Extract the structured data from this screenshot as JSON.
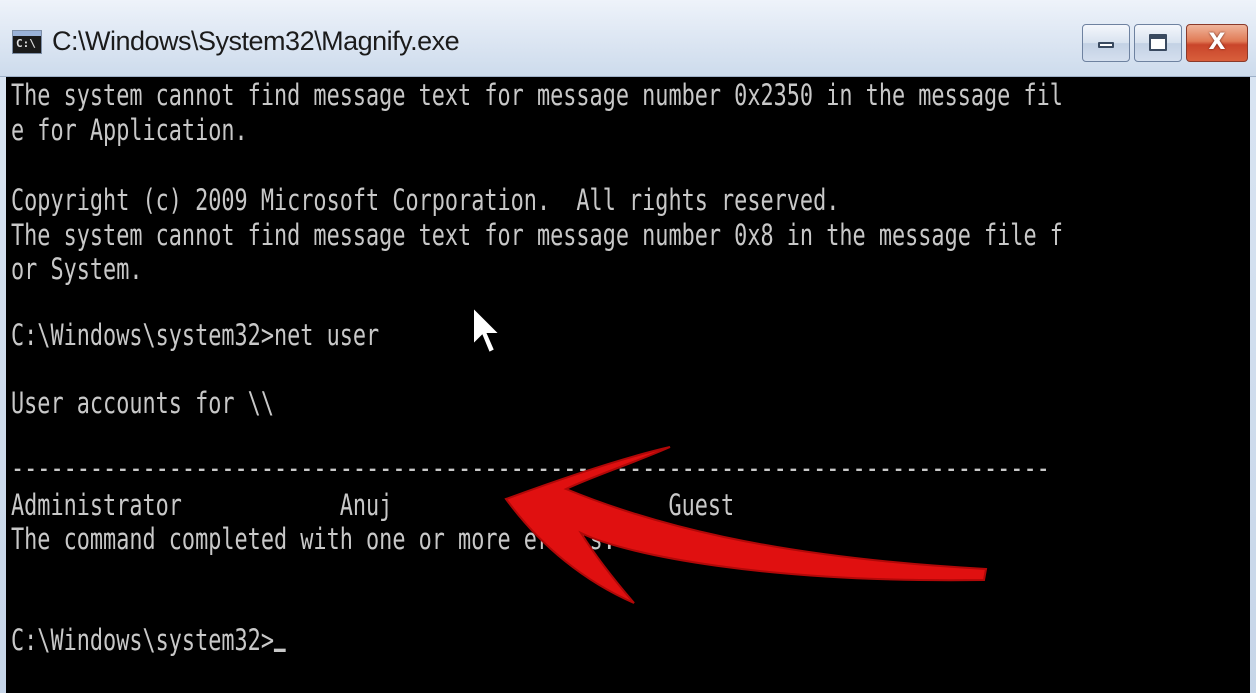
{
  "window": {
    "title": "C:\\Windows\\System32\\Magnify.exe",
    "icon": "cmd-icon",
    "icon_glyph": "C:\\",
    "buttons": {
      "minimize": "minimize-icon",
      "maximize": "maximize-icon",
      "close": "close-icon",
      "close_glyph": "X"
    },
    "colors": {
      "console_background": "#000000",
      "console_text": "#c8c8c8",
      "close_button": "#d85f3c",
      "annotation_arrow": "#e01010"
    }
  },
  "console": {
    "lines": [
      "The system cannot find message text for message number 0x2350 in the message fil",
      "e for Application.",
      "",
      "Copyright (c) 2009 Microsoft Corporation.  All rights reserved.",
      "The system cannot find message text for message number 0x8 in the message file f",
      "or System.",
      "",
      "C:\\Windows\\system32>net user",
      "",
      "User accounts for \\\\",
      "",
      "-------------------------------------------------------------------------------",
      "Administrator            Anuj                     Guest",
      "The command completed with one or more errors.",
      "",
      "",
      "C:\\Windows\\system32>"
    ]
  },
  "overlays": {
    "mouse_pointer": "mouse-pointer-icon",
    "annotation": "red-arrow-annotation"
  }
}
